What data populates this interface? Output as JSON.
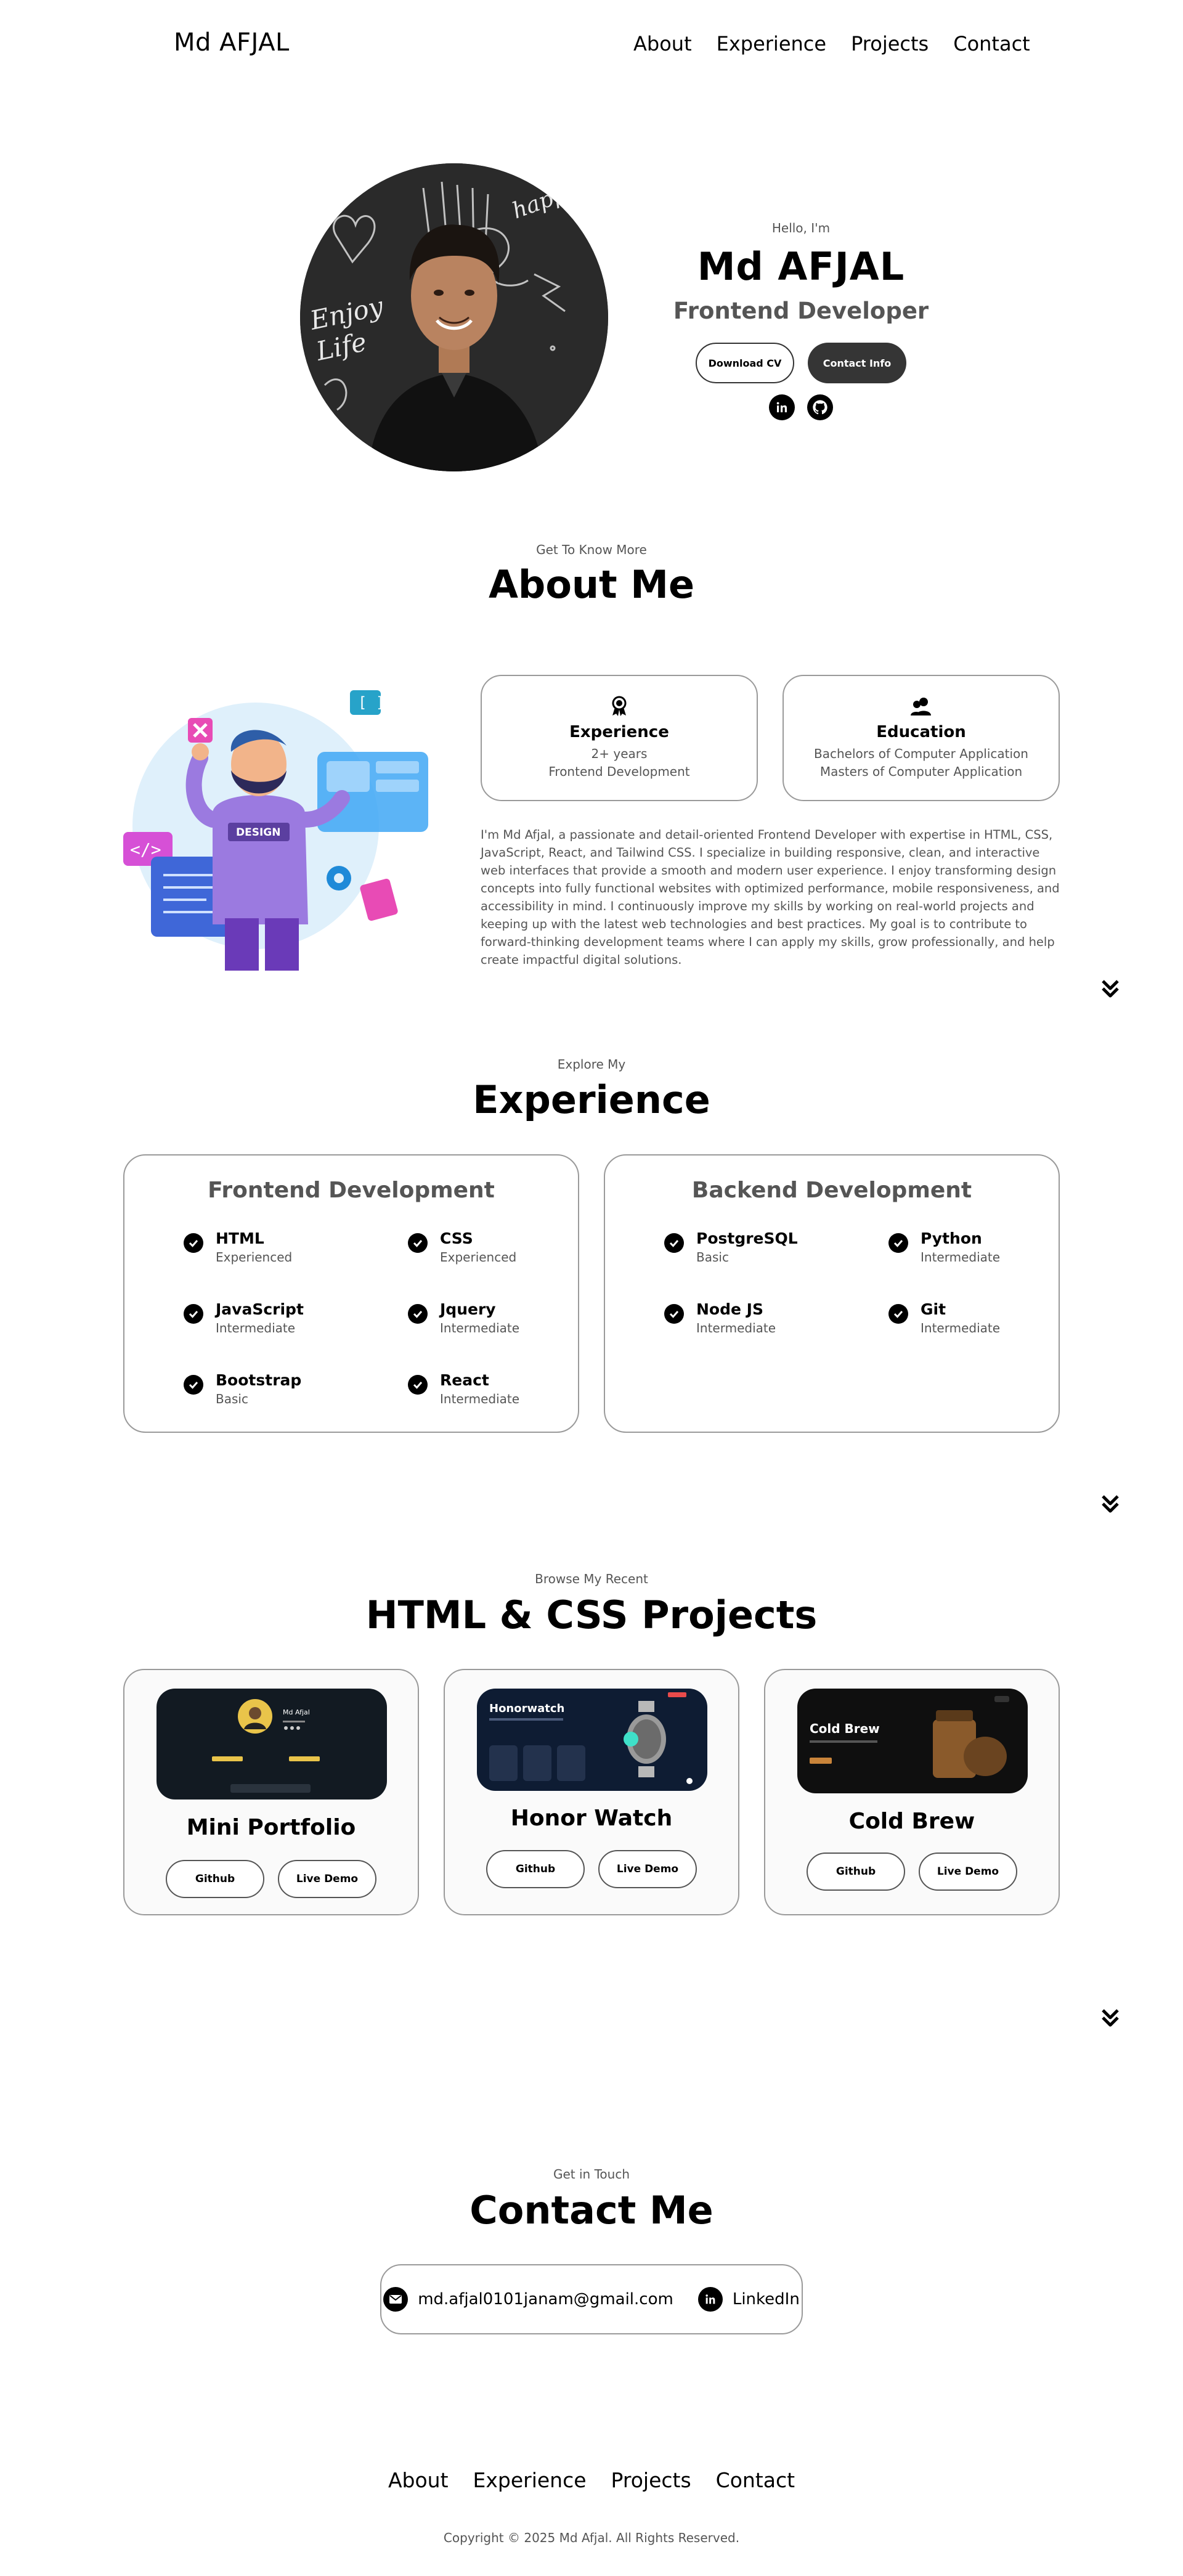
{
  "nav": {
    "logo": "Md AFJAL",
    "links": [
      "About",
      "Experience",
      "Projects",
      "Contact"
    ]
  },
  "hero": {
    "greeting": "Hello, I'm",
    "name": "Md AFJAL",
    "role": "Frontend Developer",
    "download_cv": "Download CV",
    "contact_info": "Contact Info",
    "photo_text_1": "Enjoy",
    "photo_text_2": "Life",
    "photo_text_3": "happy"
  },
  "about": {
    "subtitle": "Get To Know More",
    "title": "About Me",
    "experience_card": {
      "title": "Experience",
      "lines": [
        "2+ years",
        "Frontend Development"
      ]
    },
    "education_card": {
      "title": "Education",
      "lines": [
        "Bachelors of Computer Application",
        "Masters of Computer Application"
      ]
    },
    "illustration_badge": "DESIGN",
    "bio": "I'm Md Afjal, a passionate and detail-oriented Frontend Developer with expertise in HTML, CSS, JavaScript, React, and Tailwind CSS. I specialize in building responsive, clean, and interactive web interfaces that provide a smooth and modern user experience. I enjoy transforming design concepts into fully functional websites with optimized performance, mobile responsiveness, and accessibility in mind. I continuously improve my skills by working on real-world projects and keeping up with the latest web technologies and best practices. My goal is to contribute to forward-thinking development teams where I can apply my skills, grow professionally, and help create impactful digital solutions."
  },
  "experience": {
    "subtitle": "Explore My",
    "title": "Experience",
    "frontend": {
      "title": "Frontend Development",
      "skills": [
        {
          "name": "HTML",
          "level": "Experienced"
        },
        {
          "name": "CSS",
          "level": "Experienced"
        },
        {
          "name": "JavaScript",
          "level": "Intermediate"
        },
        {
          "name": "Jquery",
          "level": "Intermediate"
        },
        {
          "name": "Bootstrap",
          "level": "Basic"
        },
        {
          "name": "React",
          "level": "Intermediate"
        }
      ]
    },
    "backend": {
      "title": "Backend Development",
      "skills": [
        {
          "name": "PostgreSQL",
          "level": "Basic"
        },
        {
          "name": "Python",
          "level": "Intermediate"
        },
        {
          "name": "Node JS",
          "level": "Intermediate"
        },
        {
          "name": "Git",
          "level": "Intermediate"
        }
      ]
    }
  },
  "projects": {
    "subtitle": "Browse My Recent",
    "title": "HTML & CSS Projects",
    "github_label": "Github",
    "demo_label": "Live Demo",
    "items": [
      {
        "title": "Mini Portfolio",
        "thumb_text": "Md Afjal"
      },
      {
        "title": "Honor Watch",
        "thumb_text": "Honorwatch"
      },
      {
        "title": "Cold Brew",
        "thumb_text": "Cold Brew"
      }
    ]
  },
  "contact": {
    "subtitle": "Get in Touch",
    "title": "Contact Me",
    "email": "md.afjal0101janam@gmail.com",
    "linkedin": "LinkedIn"
  },
  "footer": {
    "links": [
      "About",
      "Experience",
      "Projects",
      "Contact"
    ],
    "copyright": "Copyright © 2025 Md Afjal. All Rights Reserved."
  },
  "colors": {
    "dark": "#353535",
    "muted": "#555555",
    "border": "#9a9a9a",
    "accent_purple": "#8b6ad8",
    "accent_blue": "#3fa7f5",
    "accent_pink": "#e84bb5"
  }
}
